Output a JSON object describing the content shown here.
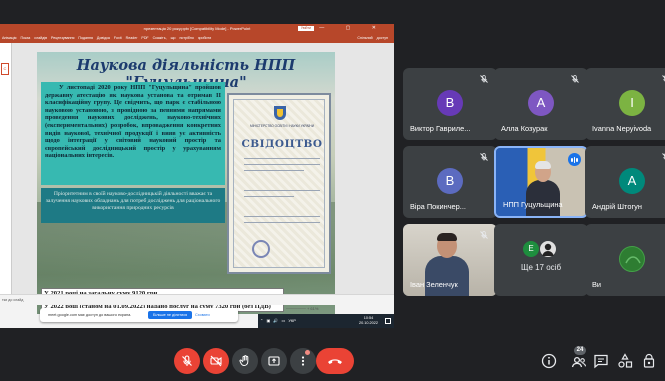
{
  "powerpoint": {
    "title": "презентація 20 року.pptx [Compatibility Mode] - PowerPoint",
    "login_label": "Увійти",
    "window_controls": "— ▢ ✕",
    "ribbon": "Анімація   Показ слайдів   Рецензування   Подання   Довідка   Foxit Reader PDF   Скажіть, що потрібно зробити",
    "share_label": "Спільний доступ",
    "left_marker": "С",
    "notes_label": "тки до слайд",
    "zoom": "─────── + 61%"
  },
  "slide": {
    "title": "Наукова діяльність НПП \"Гуцульщина\"",
    "body": "У листопаді 2020 року НПП \"Гуцульщина\" пройшов державну атестацію як наукова установа та отримав ІІ класифікаційну групу. Це свідчить, що парк є стабільною науковою установою, з провідною за певними напрямами проведення наукових досліджень, науково-технічних (експериментальних) розробок, впровадження конкретних видів наукової, технічної продукції і вияв ує активність щодо інтеграції у світовий науковий простір та європейський дослідницький простір у урахуванням національних інтересів.",
    "sub": "Пріоритетним в своїй науково-дослідницькій діяльності вважає та залучення наукових обладнань для потреб досліджень для раціонального використання природних ресурсів",
    "banner1": "У 2021 році на загальну суму 9120 грн",
    "banner2": "У 2022 році (станом на 01.09.2022) надано послуг на суму 7320 грн (без ПДВ)",
    "certificate": {
      "ministry": "МІНІСТЕРСТВО ОСВІТИ І НАУКИ УКРАЇНИ",
      "word": "СВІДОЦТВО"
    }
  },
  "browser_notice": {
    "text": "meet.google.com має доступ до вашого екрана.",
    "hide_label": "Більше не ділитися",
    "close_label": "Сховати"
  },
  "taskbar": {
    "tray": "⌃ ▣ 🔊 ▭ УКР",
    "time": "10:54",
    "date": "20.10.2022"
  },
  "participants": [
    {
      "name": "Виктор Гавриле...",
      "initial": "B",
      "color": "#673ab7"
    },
    {
      "name": "Алла Козурак",
      "initial": "A",
      "color": "#7e57c2"
    },
    {
      "name": "Ivanna Nepyivoda",
      "initial": "I",
      "color": "#7cb342"
    },
    {
      "name": "Віра Покинчер...",
      "initial": "B",
      "color": "#5c6bc0"
    },
    {
      "name": "НПП Гуцульщина",
      "initial": "",
      "color": ""
    },
    {
      "name": "Андрій Штогун",
      "initial": "A",
      "color": "#00897b"
    },
    {
      "name": "Іван Зеленчук",
      "initial": "",
      "color": ""
    },
    {
      "name": "Ще 17 осіб",
      "initial": "E",
      "color": "#1e8e3e"
    },
    {
      "name": "Ви",
      "initial": "",
      "color": "#34a853"
    }
  ],
  "participant_count": "24",
  "colors": {
    "meet_bg": "#202124",
    "tile_bg": "#3c4043",
    "hangup_red": "#ea4335",
    "powerpoint_red": "#b7472a",
    "slide_teal": "#37b9b1"
  },
  "icons": [
    "mic-off-icon",
    "camera-off-icon",
    "raise-hand-icon",
    "present-icon",
    "more-options-icon",
    "hang-up-icon",
    "info-icon",
    "people-icon",
    "chat-icon",
    "activities-icon",
    "host-controls-icon"
  ]
}
